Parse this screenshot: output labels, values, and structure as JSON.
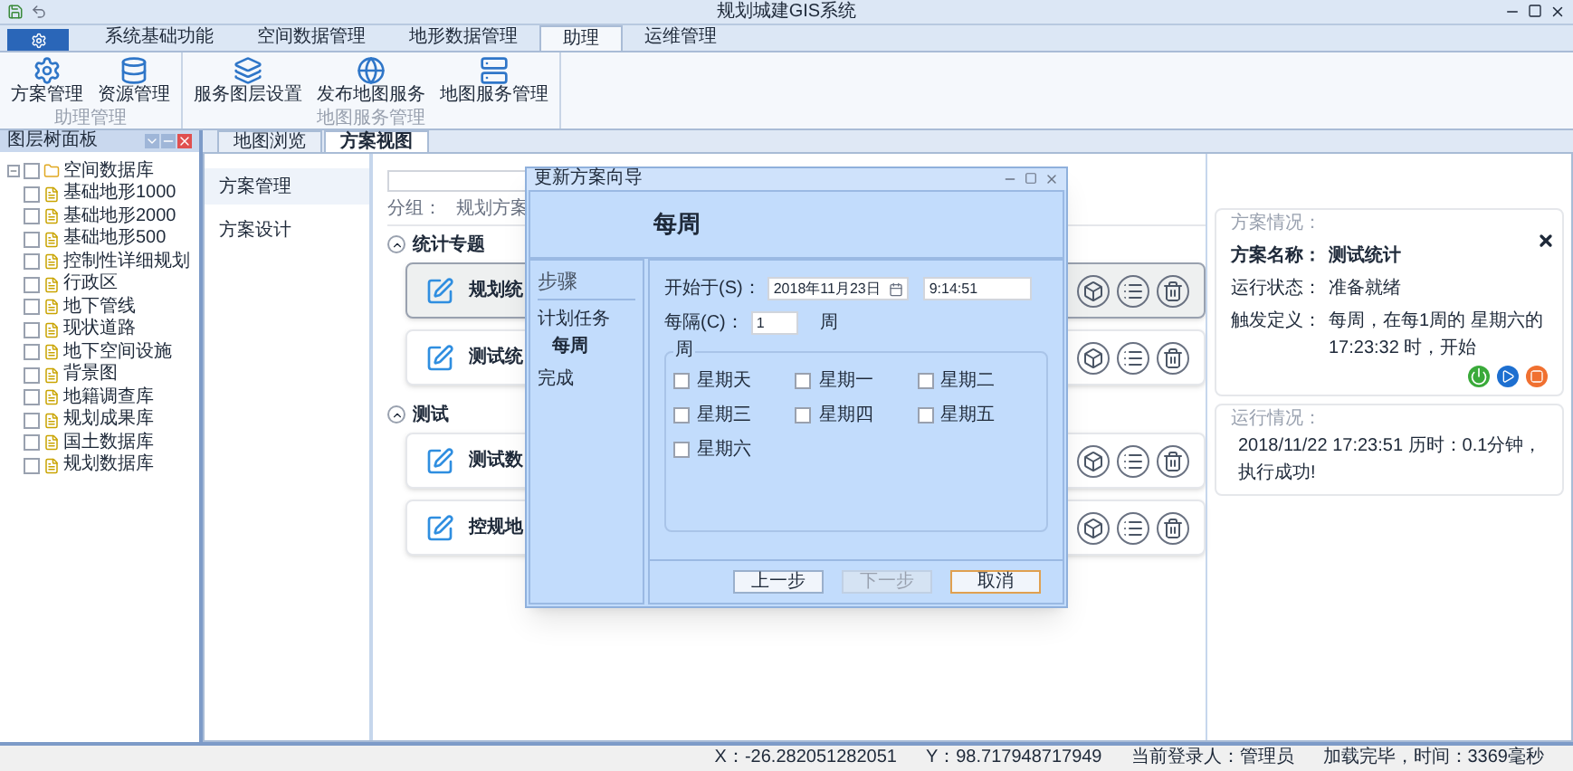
{
  "window": {
    "title": "规划城建GIS系统"
  },
  "ribbon": {
    "tabs": [
      {
        "label": "系统基础功能",
        "selected": false
      },
      {
        "label": "空间数据管理",
        "selected": false
      },
      {
        "label": "地形数据管理",
        "selected": false
      },
      {
        "label": "助理",
        "selected": true
      },
      {
        "label": "运维管理",
        "selected": false
      }
    ],
    "groups": [
      {
        "label": "助理管理",
        "buttons": [
          {
            "label": "方案管理",
            "kind": "plan"
          },
          {
            "label": "资源管理",
            "kind": "resource"
          }
        ]
      },
      {
        "label": "地图服务管理",
        "buttons": [
          {
            "label": "服务图层设置",
            "kind": "layer"
          },
          {
            "label": "发布地图服务",
            "kind": "publish"
          },
          {
            "label": "地图服务管理",
            "kind": "service"
          }
        ]
      }
    ]
  },
  "layer_panel": {
    "title": "图层树面板",
    "tree": [
      {
        "label": "空间数据库",
        "expanded": true,
        "checked": false,
        "children": [
          {
            "label": "基础地形1000",
            "checked": false
          },
          {
            "label": "基础地形2000",
            "checked": false
          },
          {
            "label": "基础地形500",
            "checked": false
          },
          {
            "label": "控制性详细规划",
            "checked": false
          },
          {
            "label": "行政区",
            "checked": false
          },
          {
            "label": "地下管线",
            "checked": false
          },
          {
            "label": "现状道路",
            "checked": false
          },
          {
            "label": "地下空间设施",
            "checked": false
          },
          {
            "label": "背景图",
            "checked": false
          },
          {
            "label": "地籍调查库",
            "checked": false
          },
          {
            "label": "规划成果库",
            "checked": false
          },
          {
            "label": "国土数据库",
            "checked": false
          },
          {
            "label": "规划数据库",
            "checked": false
          }
        ]
      }
    ]
  },
  "doc_tabs": [
    {
      "label": "地图浏览",
      "selected": false
    },
    {
      "label": "方案视图",
      "selected": true
    }
  ],
  "nav": [
    {
      "label": "方案管理",
      "selected": true
    },
    {
      "label": "方案设计",
      "selected": false
    }
  ],
  "group_filter": {
    "label": "分组：",
    "value": "规划方案"
  },
  "sections": [
    {
      "title": "统计专题",
      "expanded": true,
      "cards": [
        {
          "title": "规划统",
          "selected": true
        },
        {
          "title": "测试统",
          "selected": false
        }
      ]
    },
    {
      "title": "测试",
      "expanded": true,
      "cards": [
        {
          "title": "测试数",
          "selected": false
        },
        {
          "title": "控规地",
          "selected": false
        }
      ]
    }
  ],
  "dialog": {
    "title": "更新方案向导",
    "heading": "每周",
    "steps_title": "步骤",
    "steps": [
      {
        "label": "计划任务",
        "selected": false,
        "children": [
          {
            "label": "每周",
            "selected": true
          }
        ]
      },
      {
        "label": "完成",
        "selected": false
      }
    ],
    "start_label": "开始于(S)：",
    "start_date": "2018年11月23日",
    "start_time": "9:14:51",
    "interval_label": "每隔(C)：",
    "interval_value": "1",
    "interval_unit": "周",
    "days_group": "周",
    "days": [
      {
        "label": "星期天",
        "checked": false
      },
      {
        "label": "星期一",
        "checked": false
      },
      {
        "label": "星期二",
        "checked": false
      },
      {
        "label": "星期三",
        "checked": false
      },
      {
        "label": "星期四",
        "checked": false
      },
      {
        "label": "星期五",
        "checked": false
      },
      {
        "label": "星期六",
        "checked": false
      }
    ],
    "buttons": [
      {
        "label": "上一步",
        "disabled": false,
        "selected": false
      },
      {
        "label": "下一步",
        "disabled": true,
        "selected": false
      },
      {
        "label": "取消",
        "disabled": false,
        "selected": true
      }
    ]
  },
  "info_panel": {
    "plan_title": "方案情况：",
    "fields": [
      {
        "label": "方案名称：",
        "value": "测试统计",
        "bold": true
      },
      {
        "label": "运行状态：",
        "value": "准备就绪",
        "bold": false
      },
      {
        "label": "触发定义：",
        "value": "每周，在每1周的 星期六的17:23:32 时，开始",
        "bold": false
      }
    ],
    "run_title": "运行情况：",
    "run_text": "2018/11/22 17:23:51 历时：0.1分钟，执行成功!"
  },
  "status_bar": [
    "X：-26.282051282051",
    "Y：98.717948717949",
    "当前登录人：管理员",
    "加载完毕，时间：3369毫秒"
  ]
}
